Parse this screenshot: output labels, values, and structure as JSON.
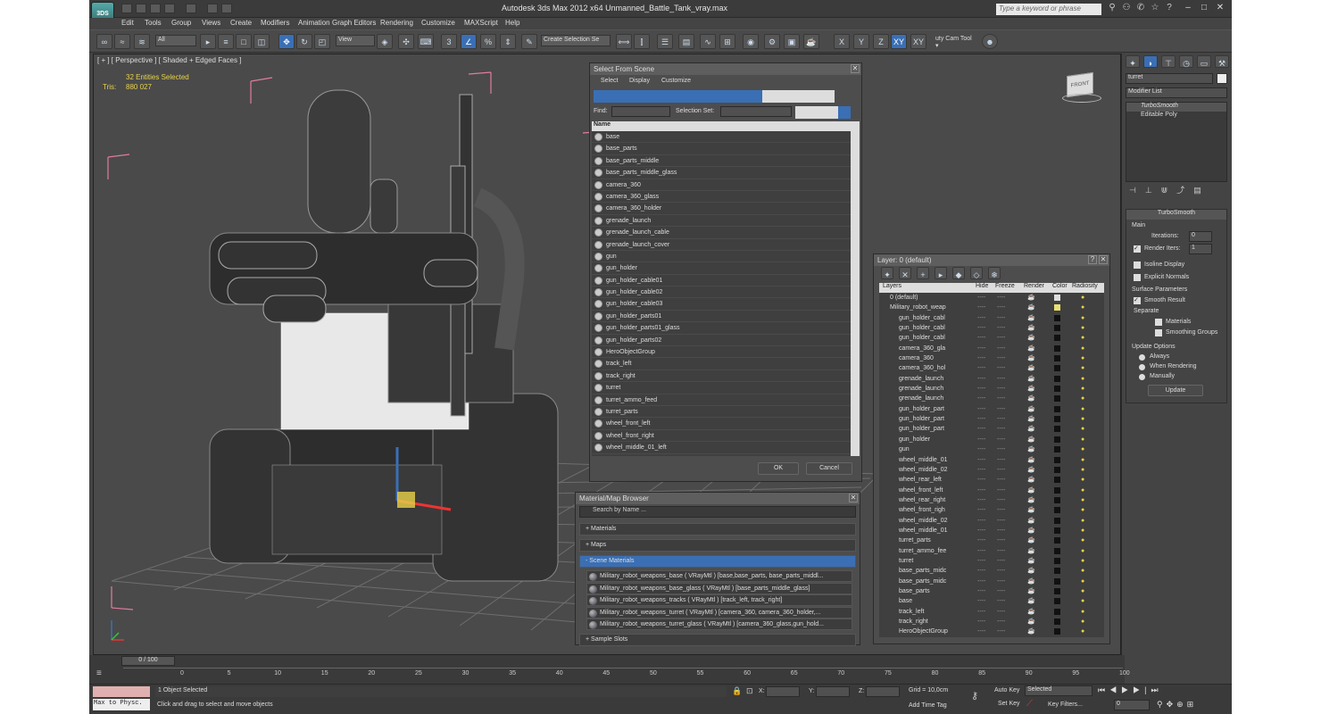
{
  "app": {
    "title": "Autodesk 3ds Max  2012 x64      Unmanned_Battle_Tank_vray.max",
    "search_placeholder": "Type a keyword or phrase",
    "logo": "3DS"
  },
  "menu": [
    "Edit",
    "Tools",
    "Group",
    "Views",
    "Create",
    "Modifiers",
    "Animation",
    "Graph Editors",
    "Rendering",
    "Customize",
    "MAXScript",
    "Help"
  ],
  "toolbar": {
    "filter": "All",
    "refcoord": "View",
    "selection_set": "Create Selection Se",
    "axes": [
      "X",
      "Y",
      "Z",
      "XY",
      "XY"
    ],
    "cam_tool": "uty Cam Tool ▾"
  },
  "viewport": {
    "label": "[ + ] [ Perspective ] [ Shaded + Edged Faces ]",
    "entities": "32 Entities Selected",
    "tris_label": "Tris:",
    "tris_value": "880 027"
  },
  "select_from_scene": {
    "title": "Select From Scene",
    "menu": [
      "Select",
      "Display",
      "Customize"
    ],
    "find_label": "Find:",
    "selection_set_label": "Selection Set:",
    "column": "Name",
    "items": [
      "base",
      "base_parts",
      "base_parts_middle",
      "base_parts_middle_glass",
      "camera_360",
      "camera_360_glass",
      "camera_360_holder",
      "grenade_launch",
      "grenade_launch_cable",
      "grenade_launch_cover",
      "gun",
      "gun_holder",
      "gun_holder_cable01",
      "gun_holder_cable02",
      "gun_holder_cable03",
      "gun_holder_parts01",
      "gun_holder_parts01_glass",
      "gun_holder_parts02",
      "HeroObjectGroup",
      "track_left",
      "track_right",
      "turret",
      "turret_ammo_feed",
      "turret_parts",
      "wheel_front_left",
      "wheel_front_right",
      "wheel_middle_01_left"
    ],
    "ok": "OK",
    "cancel": "Cancel"
  },
  "layer_panel": {
    "title": "Layer: 0 (default)",
    "help": "?",
    "columns": [
      "Layers",
      "Hide",
      "Freeze",
      "Render",
      "Color",
      "Radiosity"
    ],
    "layers": [
      "0 (default)",
      "Military_robot_weap"
    ],
    "objects": [
      "gun_holder_cabl",
      "gun_holder_cabl",
      "gun_holder_cabl",
      "camera_360_gla",
      "camera_360",
      "camera_360_hol",
      "grenade_launch",
      "grenade_launch",
      "grenade_launch",
      "gun_holder_part",
      "gun_holder_part",
      "gun_holder_part",
      "gun_holder",
      "gun",
      "wheel_middle_01",
      "wheel_middle_02",
      "wheel_rear_left",
      "wheel_front_left",
      "wheel_rear_right",
      "wheel_front_righ",
      "wheel_middle_02",
      "wheel_middle_01",
      "turret_parts",
      "turret_ammo_fee",
      "turret",
      "base_parts_midc",
      "base_parts_midc",
      "base_parts",
      "base",
      "track_left",
      "track_right",
      "HeroObjectGroup"
    ],
    "dash": "----"
  },
  "material_browser": {
    "title": "Material/Map Browser",
    "search": "Search by Name ...",
    "rollouts": [
      "+ Materials",
      "+ Maps",
      "- Scene Materials",
      "+ Sample Slots"
    ],
    "materials": [
      "Military_robot_weapons_base ( VRayMtl ) [base,base_parts, base_parts_middl...",
      "Military_robot_weapons_base_glass ( VRayMtl ) [base_parts_middle_glass]",
      "Military_robot_weapons_tracks ( VRayMtl ) [track_left, track_right]",
      "Military_robot_weapons_turret  ( VRayMtl ) [camera_360, camera_360_holder,...",
      "Military_robot_weapons_turret_glass ( VRayMtl ) [camera_360_glass,gun_hold..."
    ]
  },
  "command_panel": {
    "object_name": "turret",
    "modifier_list": "Modifier List",
    "stack": [
      "TurboSmooth",
      "Editable Poly"
    ],
    "turbosmooth_title": "TurboSmooth",
    "main": "Main",
    "iterations_label": "Iterations:",
    "iterations": "0",
    "render_iters_label": "Render Iters:",
    "render_iters": "1",
    "isoline": "Isoline Display",
    "explicit": "Explicit Normals",
    "surface_params": "Surface Parameters",
    "smooth_result": "Smooth Result",
    "separate": "Separate",
    "materials": "Materials",
    "smoothing_groups": "Smoothing Groups",
    "update_options": "Update Options",
    "always": "Always",
    "when_rendering": "When Rendering",
    "manually": "Manually",
    "update": "Update"
  },
  "timeline": {
    "frame": "0 / 100",
    "ticks": [
      "0",
      "5",
      "10",
      "15",
      "20",
      "25",
      "30",
      "35",
      "40",
      "45",
      "50",
      "55",
      "60",
      "65",
      "70",
      "75",
      "80",
      "85",
      "90",
      "95",
      "100"
    ]
  },
  "status": {
    "max_to_physc": "Max to Physc.",
    "selected": "1 Object Selected",
    "prompt": "Click and drag to select and move objects",
    "x": "X:",
    "y": "Y:",
    "z": "Z:",
    "grid": "Grid = 10,0cm",
    "add_time_tag": "Add Time Tag",
    "auto_key": "Auto Key",
    "set_key": "Set Key",
    "selected_dd": "Selected",
    "key_filters": "Key Filters...",
    "frame_field": "0"
  },
  "colors": {
    "accent": "#3a6fb5",
    "stats": "#e8d24a",
    "bbox": "#e07ca0"
  }
}
